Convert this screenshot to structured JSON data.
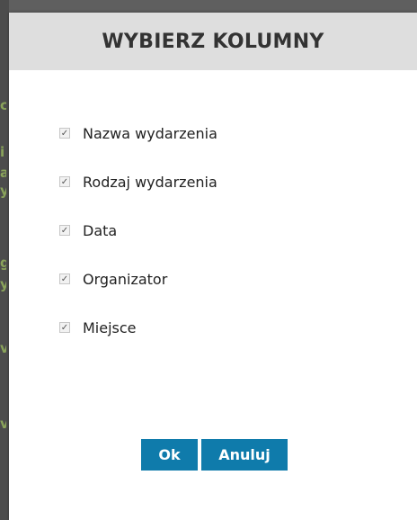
{
  "modal": {
    "title": "WYBIERZ KOLUMNY",
    "columns": [
      {
        "label": "Nazwa wydarzenia",
        "checked": true
      },
      {
        "label": "Rodzaj wydarzenia",
        "checked": true
      },
      {
        "label": "Data",
        "checked": true
      },
      {
        "label": "Organizator",
        "checked": true
      },
      {
        "label": "Miejsce",
        "checked": true
      }
    ],
    "ok_label": "Ok",
    "cancel_label": "Anuluj"
  },
  "colors": {
    "header_background": "#dedede",
    "button_background": "#0f7bab",
    "overlay": "#5f5f5f"
  }
}
